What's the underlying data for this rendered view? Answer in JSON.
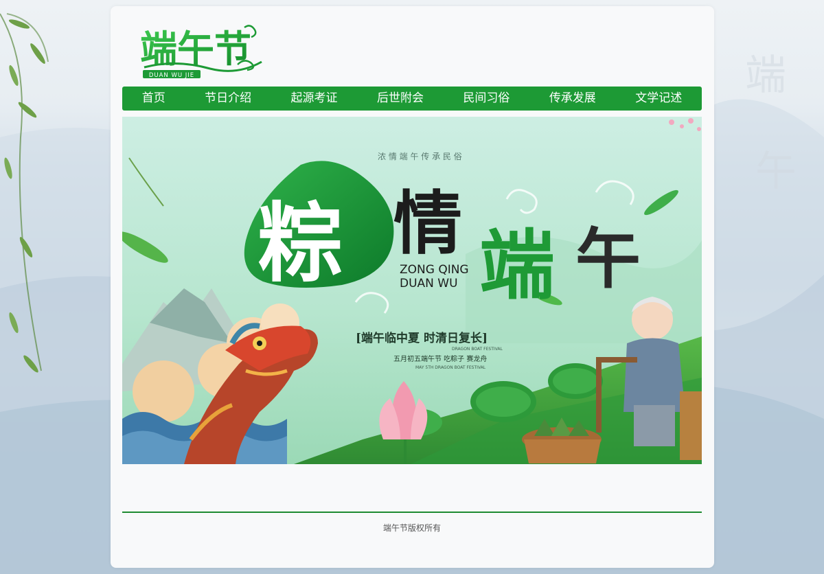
{
  "logo": {
    "title": "端午节",
    "subtitle": "DUAN WU JIE"
  },
  "nav": {
    "items": [
      {
        "label": "首页"
      },
      {
        "label": "节日介绍"
      },
      {
        "label": "起源考证"
      },
      {
        "label": "后世附会"
      },
      {
        "label": "民间习俗"
      },
      {
        "label": "传承发展"
      },
      {
        "label": "文学记述"
      }
    ]
  },
  "banner": {
    "top_text": "浓 情 端 午 传 承 民 俗",
    "title_char_1": "粽",
    "title_char_2": "情",
    "title_char_3": "端",
    "title_char_4": "午",
    "pinyin_line_1": "ZONG QING",
    "pinyin_line_2": "DUAN WU",
    "slogan": "[端午临中夏  时清日复长]",
    "small_caption": "DRAGON BOAT FESTIVAL",
    "sub_line": "五月初五端午节  吃粽子  赛龙舟",
    "sub_line_en": "MAY 5TH DRAGON BOAT FESTIVAL"
  },
  "footer": {
    "copyright": "端午节版权所有"
  },
  "colors": {
    "nav_green": "#1d9a35",
    "logo_green": "#22a43a",
    "page_bg": "#f8f9fa"
  }
}
